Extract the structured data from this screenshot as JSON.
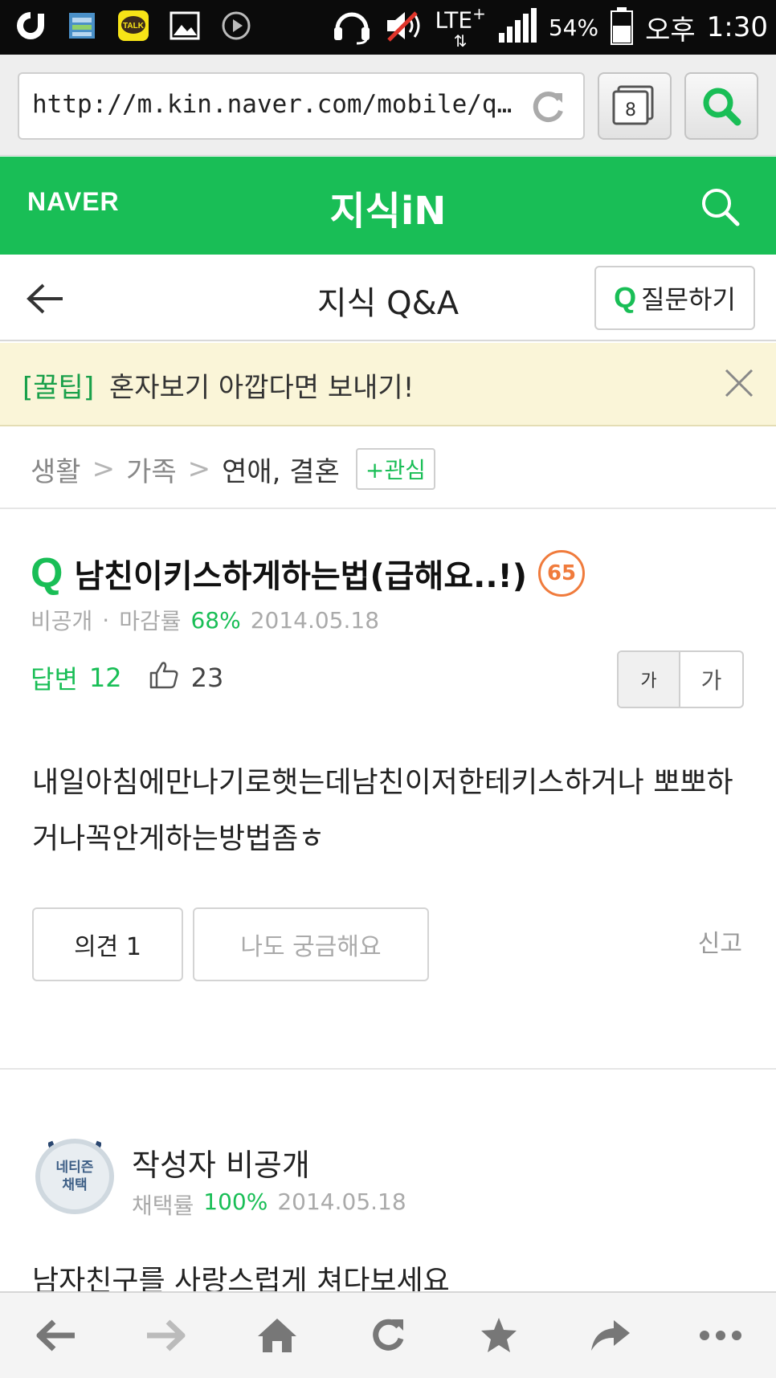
{
  "status_bar": {
    "lte": "LTE",
    "lte_plus": "+",
    "battery": "54%",
    "time_period": "오후",
    "time": "1:30",
    "kakao_label": "TALK"
  },
  "browser": {
    "url": "http://m.kin.naver.com/mobile/q...",
    "tab_count": "8"
  },
  "header": {
    "logo": "NAVER",
    "title": "지식iN"
  },
  "subheader": {
    "title": "지식 Q&A",
    "ask_q": "Q",
    "ask_label": "질문하기"
  },
  "tip": {
    "tag": "[꿀팁]",
    "text": "혼자보기 아깝다면 보내기!"
  },
  "breadcrumb": {
    "items": [
      "생활",
      "가족",
      "연애, 결혼"
    ],
    "separator": ">",
    "fav_label": "+관심"
  },
  "question": {
    "mark": "Q",
    "title": "남친이키스하게하는법(급해요..!)",
    "badge": "65",
    "author": "비공개",
    "dot": "·",
    "rate_label": "마감률",
    "rate": "68%",
    "date": "2014.05.18",
    "answers_label": "답변",
    "answers_count": "12",
    "likes": "23",
    "font_small": "가",
    "font_large": "가",
    "body": "내일아침에만나기로햇는데남친이저한테키스하거나 뽀뽀하거나꼭안게하는방법좀ㅎ",
    "opinion_label": "의견 1",
    "curious_label": "나도 궁금해요",
    "report_label": "신고"
  },
  "answer": {
    "avatar_line1": "네티즌",
    "avatar_line2": "채택",
    "author": "작성자 비공개",
    "rate_label": "채택률",
    "rate": "100%",
    "date": "2014.05.18",
    "body": "남자친구를 사랑스럽게 쳐다보세요"
  },
  "colors": {
    "brand": "#19be56",
    "badge": "#f07b3c",
    "tip_bg": "#faf5d8"
  },
  "icons": [
    "back-arrow-icon",
    "forward-arrow-icon",
    "home-icon",
    "reload-icon",
    "star-icon",
    "share-icon",
    "more-icon",
    "search-icon",
    "close-icon",
    "thumbs-up-icon"
  ]
}
